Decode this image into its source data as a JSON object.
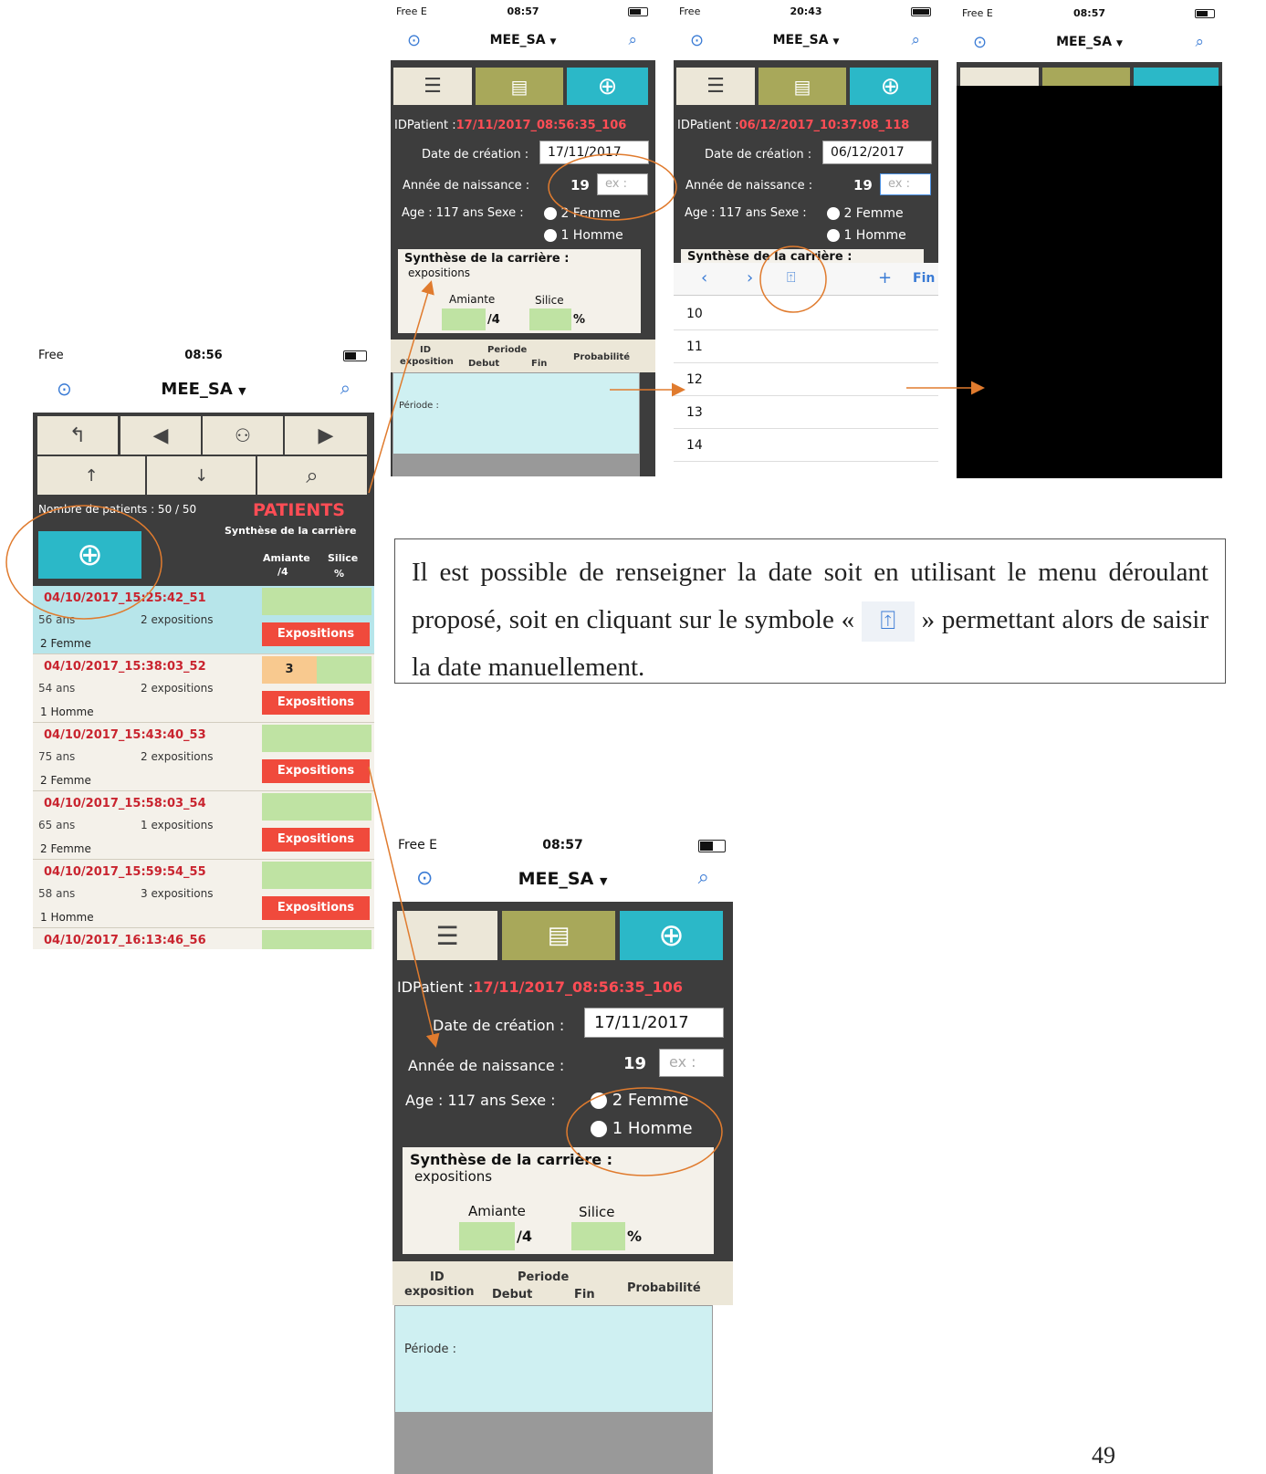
{
  "status": {
    "free": "Free",
    "free_e": "Free  E",
    "t1": "08:57",
    "t2": "20:43",
    "t3": "08:57",
    "t_list": "08:56",
    "t_big": "08:57"
  },
  "app": {
    "title": "MEE_SA"
  },
  "form1": {
    "id_label": "IDPatient :",
    "id": "17/11/2017_08:56:35_106",
    "date_label": "Date de création :",
    "date": "17/11/2017",
    "birth_label": "Année de naissance :",
    "birth_prefix": "19",
    "birth_placeholder": "ex :",
    "age": "Age : 117 ans",
    "sexe_label": "Sexe :",
    "opt1": "2 Femme",
    "opt2": "1 Homme",
    "synth_title": "Synthèse de la carrière :",
    "synth_sub": "expositions",
    "amiante": "Amiante",
    "silice": "Silice",
    "per4": "/4",
    "pct": "%",
    "col_id": "ID",
    "col_expo": "exposition",
    "col_periode": "Periode",
    "col_debut": "Debut",
    "col_fin": "Fin",
    "col_prob": "Probabilité",
    "periode": "Période :"
  },
  "form2": {
    "id": "06/12/2017_10:37:08_118",
    "date": "06/12/2017",
    "synth_title": "Synthèse de la carrière :",
    "fin": "Fin",
    "years": [
      "10",
      "11",
      "12",
      "13",
      "14"
    ]
  },
  "list": {
    "count": "Nombre de patients : 50 / 50",
    "title": "PATIENTS",
    "subtitle": "Synthèse de la carrière",
    "amiante": "Amiante",
    "per4": "/4",
    "silice": "Silice",
    "pct": "%",
    "btn": "Expositions",
    "rows": [
      {
        "id": "04/10/2017_15:25:42_51",
        "age": "56 ans",
        "exp": "2 expositions",
        "sex": "2 Femme",
        "badge": ""
      },
      {
        "id": "04/10/2017_15:38:03_52",
        "age": "54 ans",
        "exp": "2 expositions",
        "sex": "1 Homme",
        "badge": "3"
      },
      {
        "id": "04/10/2017_15:43:40_53",
        "age": "75 ans",
        "exp": "2 expositions",
        "sex": "2 Femme",
        "badge": ""
      },
      {
        "id": "04/10/2017_15:58:03_54",
        "age": "65 ans",
        "exp": "1 expositions",
        "sex": "2 Femme",
        "badge": ""
      },
      {
        "id": "04/10/2017_15:59:54_55",
        "age": "58 ans",
        "exp": "3 expositions",
        "sex": "1 Homme",
        "badge": ""
      },
      {
        "id": "04/10/2017_16:13:46_56",
        "age": "",
        "exp": "",
        "sex": "",
        "badge": ""
      }
    ]
  },
  "note": {
    "part1": "Il est possible de renseigner la date soit en utilisant le menu déroulant proposé, soit en cliquant sur le symbole «",
    "part2": "» permettant alors de saisir la date manuellement."
  },
  "page_number": "49",
  "colors": {
    "accent": "#e07b2e",
    "teal": "#2bb8c8",
    "olive": "#a8a85a",
    "red": "#ff4d55",
    "green": "#bfe3a3"
  }
}
